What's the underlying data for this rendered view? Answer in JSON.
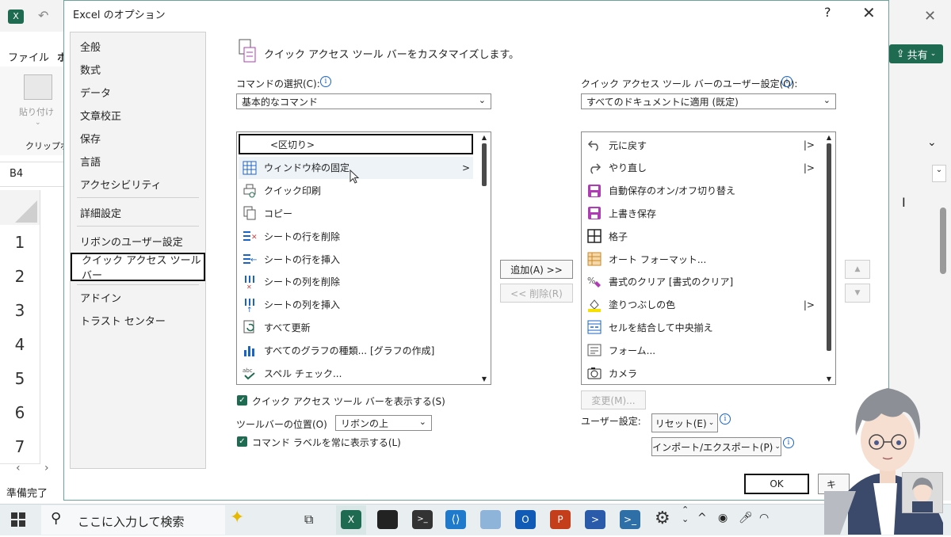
{
  "excel": {
    "tab_file": "ファイル",
    "tab_home_partial": "ホ",
    "paste_label": "貼り付け",
    "clipboard_label": "クリップボ",
    "namebox": "B4",
    "rows": [
      "1",
      "2",
      "3",
      "4",
      "5",
      "6",
      "7"
    ],
    "status": "準備完了",
    "share_label": "共有"
  },
  "dialog": {
    "title": "Excel のオプション",
    "help": "?",
    "close": "✕",
    "nav": [
      {
        "label": "全般"
      },
      {
        "label": "数式"
      },
      {
        "label": "データ"
      },
      {
        "label": "文章校正"
      },
      {
        "label": "保存"
      },
      {
        "label": "言語"
      },
      {
        "label": "アクセシビリティ"
      },
      {
        "label": "詳細設定"
      },
      {
        "label": "リボンのユーザー設定"
      },
      {
        "label": "クイック アクセス ツール バー"
      },
      {
        "label": "アドイン"
      },
      {
        "label": "トラスト センター"
      }
    ],
    "header": "クイック アクセス ツール バーをカスタマイズします。",
    "choose_label": "コマンドの選択(C):",
    "choose_value": "基本的なコマンド",
    "customize_label": "クイック アクセス ツール バーのユーザー設定(Q):",
    "customize_value": "すべてのドキュメントに適用 (既定)",
    "commands": [
      {
        "label": "<区切り>",
        "icon": "separator-icon"
      },
      {
        "label": "ウィンドウ枠の固定",
        "icon": "freeze-panes-icon",
        "arrow": ">"
      },
      {
        "label": "クイック印刷",
        "icon": "quick-print-icon"
      },
      {
        "label": "コピー",
        "icon": "copy-icon"
      },
      {
        "label": "シートの行を削除",
        "icon": "delete-row-icon"
      },
      {
        "label": "シートの行を挿入",
        "icon": "insert-row-icon"
      },
      {
        "label": "シートの列を削除",
        "icon": "delete-column-icon"
      },
      {
        "label": "シートの列を挿入",
        "icon": "insert-column-icon"
      },
      {
        "label": "すべて更新",
        "icon": "refresh-all-icon"
      },
      {
        "label": "すべてのグラフの種類... [グラフの作成]",
        "icon": "chart-icon"
      },
      {
        "label": "スペル チェック...",
        "icon": "spell-check-icon"
      }
    ],
    "qat_items": [
      {
        "label": "元に戻す",
        "icon": "undo-icon",
        "arrow": "|>"
      },
      {
        "label": "やり直し",
        "icon": "redo-icon",
        "arrow": "|>"
      },
      {
        "label": "自動保存のオン/オフ切り替え",
        "icon": "autosave-icon"
      },
      {
        "label": "上書き保存",
        "icon": "save-icon"
      },
      {
        "label": "格子",
        "icon": "borders-icon"
      },
      {
        "label": "オート フォーマット...",
        "icon": "autoformat-icon"
      },
      {
        "label": "書式のクリア [書式のクリア]",
        "icon": "clear-format-icon"
      },
      {
        "label": "塗りつぶしの色",
        "icon": "fill-color-icon",
        "arrow": "|>"
      },
      {
        "label": "セルを結合して中央揃え",
        "icon": "merge-center-icon"
      },
      {
        "label": "フォーム...",
        "icon": "form-icon"
      },
      {
        "label": "カメラ",
        "icon": "camera-icon"
      }
    ],
    "add_button": "追加(A) >>",
    "remove_button": "<< 削除(R)",
    "modify_button": "変更(M)...",
    "show_qat_label": "クイック アクセス ツール バーを表示する(S)",
    "toolbar_pos_label": "ツールバーの位置(O)",
    "toolbar_pos_value": "リボンの上",
    "show_labels_label": "コマンド ラベルを常に表示する(L)",
    "user_settings_label": "ユーザー設定:",
    "reset_button": "リセット(E)",
    "import_export_button": "インポート/エクスポート(P)",
    "ok_button": "OK",
    "cancel_partial": "キ"
  },
  "taskbar": {
    "search_placeholder": "ここに入力して検索"
  },
  "colors": {
    "excel_green": "#1f6b52",
    "accent_border": "#6aa39b",
    "purple_save": "#b03cb5"
  }
}
